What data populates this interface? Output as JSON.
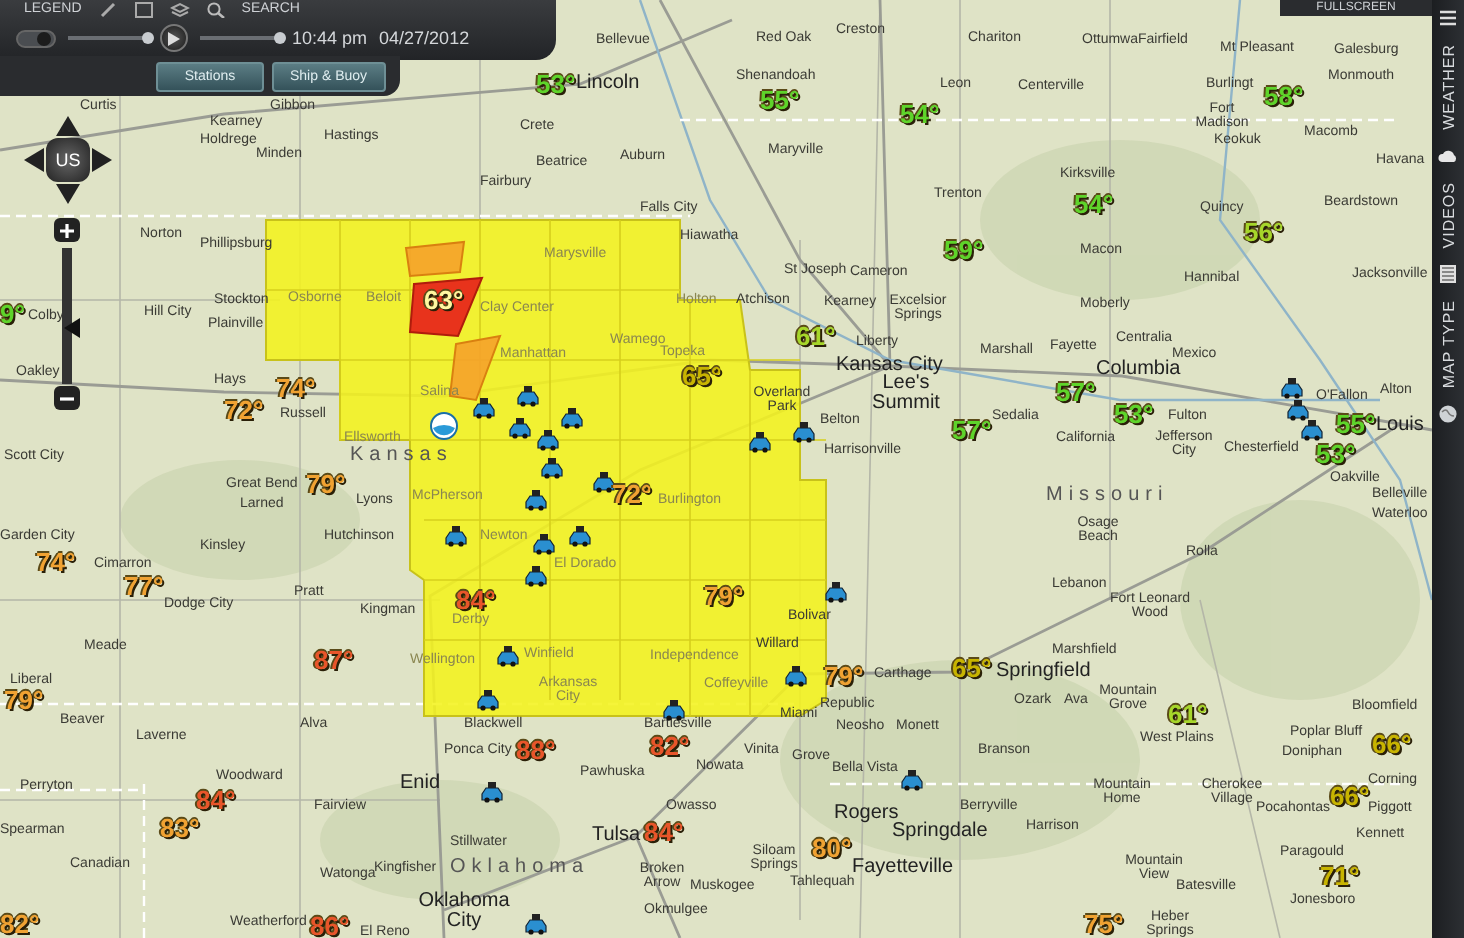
{
  "toolbar": {
    "menu_items": [
      "LEGEND",
      "SEARCH"
    ],
    "fullscreen": "FULLSCREEN"
  },
  "playback": {
    "toggle": {
      "on": true
    },
    "speed": {
      "level": 1
    },
    "time": "10:44 pm",
    "date": "04/27/2012",
    "timeline": {
      "level": 1
    }
  },
  "layer_buttons": [
    {
      "label": "Stations"
    },
    {
      "label": "Ship & Buoy"
    }
  ],
  "side_tabs": [
    "WEATHER",
    "VIDEOS",
    "MAP TYPE"
  ],
  "pan_control": {
    "label": "US"
  },
  "zoom_slider": {
    "level": 0.4
  },
  "cities": [
    {
      "name": "Bellevue",
      "kind": "town"
    },
    {
      "name": "Lincoln",
      "kind": "major"
    },
    {
      "name": "Curtis",
      "kind": "town"
    },
    {
      "name": "Kearney",
      "kind": "town"
    },
    {
      "name": "Gibbon",
      "kind": "town"
    },
    {
      "name": "Holdrege",
      "kind": "town"
    },
    {
      "name": "Minden",
      "kind": "town"
    },
    {
      "name": "Hastings",
      "kind": "town"
    },
    {
      "name": "Crete",
      "kind": "town"
    },
    {
      "name": "Beatrice",
      "kind": "town"
    },
    {
      "name": "Fairbury",
      "kind": "town"
    },
    {
      "name": "Auburn",
      "kind": "town"
    },
    {
      "name": "Falls City",
      "kind": "town"
    },
    {
      "name": "Hiawatha",
      "kind": "town"
    },
    {
      "name": "Norton",
      "kind": "town"
    },
    {
      "name": "Red Oak",
      "kind": "town"
    },
    {
      "name": "Creston",
      "kind": "town"
    },
    {
      "name": "Chariton",
      "kind": "town"
    },
    {
      "name": "Ottumwa",
      "kind": "town"
    },
    {
      "name": "Fairfield",
      "kind": "town"
    },
    {
      "name": "Mt Pleasant",
      "kind": "town"
    },
    {
      "name": "Galesburg",
      "kind": "town"
    },
    {
      "name": "Shenandoah",
      "kind": "town"
    },
    {
      "name": "Leon",
      "kind": "town"
    },
    {
      "name": "Centerville",
      "kind": "town"
    },
    {
      "name": "Burlingt",
      "kind": "town"
    },
    {
      "name": "Fort Madison",
      "kind": "town"
    },
    {
      "name": "Monmouth",
      "kind": "town"
    },
    {
      "name": "Keokuk",
      "kind": "town"
    },
    {
      "name": "Macomb",
      "kind": "town"
    },
    {
      "name": "Havana",
      "kind": "town"
    },
    {
      "name": "Maryville",
      "kind": "town"
    },
    {
      "name": "Kirksville",
      "kind": "town"
    },
    {
      "name": "Trenton",
      "kind": "town"
    },
    {
      "name": "Quincy",
      "kind": "town"
    },
    {
      "name": "Beardstown",
      "kind": "town"
    },
    {
      "name": "Phillipsburg",
      "kind": "town"
    },
    {
      "name": "Hill City",
      "kind": "town"
    },
    {
      "name": "Stockton",
      "kind": "town"
    },
    {
      "name": "Plainville",
      "kind": "town"
    },
    {
      "name": "Colby",
      "kind": "town"
    },
    {
      "name": "Oakley",
      "kind": "town"
    },
    {
      "name": "Hays",
      "kind": "town"
    },
    {
      "name": "Russell",
      "kind": "town"
    },
    {
      "name": "Scott City",
      "kind": "town"
    },
    {
      "name": "Kansas",
      "kind": "state"
    },
    {
      "name": "Great Bend",
      "kind": "town"
    },
    {
      "name": "Larned",
      "kind": "town"
    },
    {
      "name": "Lyons",
      "kind": "town"
    },
    {
      "name": "Garden City",
      "kind": "town"
    },
    {
      "name": "Hutchinson",
      "kind": "town"
    },
    {
      "name": "Cimarron",
      "kind": "town"
    },
    {
      "name": "Kinsley",
      "kind": "town"
    },
    {
      "name": "Osborne",
      "kind": "overlay"
    },
    {
      "name": "Beloit",
      "kind": "overlay"
    },
    {
      "name": "Marysville",
      "kind": "overlay"
    },
    {
      "name": "Clay Center",
      "kind": "overlay"
    },
    {
      "name": "Manhattan",
      "kind": "overlay"
    },
    {
      "name": "Holton",
      "kind": "overlay"
    },
    {
      "name": "Wamego",
      "kind": "overlay"
    },
    {
      "name": "Topeka",
      "kind": "overlay"
    },
    {
      "name": "Salina",
      "kind": "overlay"
    },
    {
      "name": "Ellsworth",
      "kind": "overlay"
    },
    {
      "name": "McPherson",
      "kind": "overlay"
    },
    {
      "name": "Newton",
      "kind": "overlay"
    },
    {
      "name": "El Dorado",
      "kind": "overlay"
    },
    {
      "name": "Burlington",
      "kind": "overlay"
    },
    {
      "name": "St Joseph",
      "kind": "town"
    },
    {
      "name": "Cameron",
      "kind": "town"
    },
    {
      "name": "Macon",
      "kind": "town"
    },
    {
      "name": "Hannibal",
      "kind": "town"
    },
    {
      "name": "Jacksonville",
      "kind": "town"
    },
    {
      "name": "Atchison",
      "kind": "town"
    },
    {
      "name": "Kearney",
      "kind": "town"
    },
    {
      "name": "Excelsior Springs",
      "kind": "town"
    },
    {
      "name": "Moberly",
      "kind": "town"
    },
    {
      "name": "Liberty",
      "kind": "town"
    },
    {
      "name": "Marshall",
      "kind": "town"
    },
    {
      "name": "Fayette",
      "kind": "town"
    },
    {
      "name": "Centralia",
      "kind": "town"
    },
    {
      "name": "Mexico",
      "kind": "town"
    },
    {
      "name": "Kansas City",
      "kind": "major"
    },
    {
      "name": "Columbia",
      "kind": "major"
    },
    {
      "name": "Overland Park",
      "kind": "town"
    },
    {
      "name": "Lee's Summit",
      "kind": "major"
    },
    {
      "name": "Belton",
      "kind": "town"
    },
    {
      "name": "Harrisonville",
      "kind": "town"
    },
    {
      "name": "Sedalia",
      "kind": "town"
    },
    {
      "name": "California",
      "kind": "town"
    },
    {
      "name": "Fulton",
      "kind": "town"
    },
    {
      "name": "Jefferson City",
      "kind": "town"
    },
    {
      "name": "O'Fallon",
      "kind": "town"
    },
    {
      "name": "Alton",
      "kind": "town"
    },
    {
      "name": "Chesterfield",
      "kind": "town"
    },
    {
      "name": "Louis",
      "kind": "major"
    },
    {
      "name": "Oakville",
      "kind": "town"
    },
    {
      "name": "Belleville",
      "kind": "town"
    },
    {
      "name": "Waterloo",
      "kind": "town"
    },
    {
      "name": "Missouri",
      "kind": "state"
    },
    {
      "name": "Osage Beach",
      "kind": "town"
    },
    {
      "name": "Rolla",
      "kind": "town"
    },
    {
      "name": "Lebanon",
      "kind": "town"
    },
    {
      "name": "Dodge City",
      "kind": "town"
    },
    {
      "name": "Pratt",
      "kind": "town"
    },
    {
      "name": "Kingman",
      "kind": "town"
    },
    {
      "name": "Derby",
      "kind": "overlay"
    },
    {
      "name": "Wellington",
      "kind": "overlay"
    },
    {
      "name": "Winfield",
      "kind": "overlay"
    },
    {
      "name": "Arkansas City",
      "kind": "overlay"
    },
    {
      "name": "Independence",
      "kind": "overlay"
    },
    {
      "name": "Coffeyville",
      "kind": "overlay"
    },
    {
      "name": "Meade",
      "kind": "town"
    },
    {
      "name": "Liberal",
      "kind": "town"
    },
    {
      "name": "Beaver",
      "kind": "town"
    },
    {
      "name": "Laverne",
      "kind": "town"
    },
    {
      "name": "Alva",
      "kind": "town"
    },
    {
      "name": "Blackwell",
      "kind": "town"
    },
    {
      "name": "Ponca City",
      "kind": "town"
    },
    {
      "name": "Pawhuska",
      "kind": "town"
    },
    {
      "name": "Bartlesville",
      "kind": "town"
    },
    {
      "name": "Nowata",
      "kind": "town"
    },
    {
      "name": "Perryton",
      "kind": "town"
    },
    {
      "name": "Woodward",
      "kind": "town"
    },
    {
      "name": "Enid",
      "kind": "major"
    },
    {
      "name": "Fairview",
      "kind": "town"
    },
    {
      "name": "Owasso",
      "kind": "town"
    },
    {
      "name": "Spearman",
      "kind": "town"
    },
    {
      "name": "Stillwater",
      "kind": "town"
    },
    {
      "name": "Oklahoma",
      "kind": "state"
    },
    {
      "name": "Tulsa",
      "kind": "major"
    },
    {
      "name": "Broken Arrow",
      "kind": "town"
    },
    {
      "name": "Canadian",
      "kind": "town"
    },
    {
      "name": "Watonga",
      "kind": "town"
    },
    {
      "name": "Kingfisher",
      "kind": "town"
    },
    {
      "name": "Weatherford",
      "kind": "town"
    },
    {
      "name": "El Reno",
      "kind": "town"
    },
    {
      "name": "Oklahoma City",
      "kind": "major"
    },
    {
      "name": "Muskogee",
      "kind": "town"
    },
    {
      "name": "Okmulgee",
      "kind": "town"
    },
    {
      "name": "Bolivar",
      "kind": "town"
    },
    {
      "name": "Fort Leonard Wood",
      "kind": "town"
    },
    {
      "name": "Willard",
      "kind": "town"
    },
    {
      "name": "Marshfield",
      "kind": "town"
    },
    {
      "name": "Carthage",
      "kind": "town"
    },
    {
      "name": "Springfield",
      "kind": "major"
    },
    {
      "name": "Miami",
      "kind": "town"
    },
    {
      "name": "Republic",
      "kind": "town"
    },
    {
      "name": "Ozark",
      "kind": "town"
    },
    {
      "name": "Ava",
      "kind": "town"
    },
    {
      "name": "Mountain Grove",
      "kind": "town"
    },
    {
      "name": "Bloomfield",
      "kind": "town"
    },
    {
      "name": "Neosho",
      "kind": "town"
    },
    {
      "name": "Monett",
      "kind": "town"
    },
    {
      "name": "West Plains",
      "kind": "town"
    },
    {
      "name": "Poplar Bluff",
      "kind": "town"
    },
    {
      "name": "Vinita",
      "kind": "town"
    },
    {
      "name": "Grove",
      "kind": "town"
    },
    {
      "name": "Bella Vista",
      "kind": "town"
    },
    {
      "name": "Branson",
      "kind": "town"
    },
    {
      "name": "Doniphan",
      "kind": "town"
    },
    {
      "name": "Mountain Home",
      "kind": "town"
    },
    {
      "name": "Cherokee Village",
      "kind": "town"
    },
    {
      "name": "Corning",
      "kind": "town"
    },
    {
      "name": "Rogers",
      "kind": "major"
    },
    {
      "name": "Berryville",
      "kind": "town"
    },
    {
      "name": "Pocahontas",
      "kind": "town"
    },
    {
      "name": "Piggott",
      "kind": "town"
    },
    {
      "name": "Springdale",
      "kind": "major"
    },
    {
      "name": "Harrison",
      "kind": "town"
    },
    {
      "name": "Kennett",
      "kind": "town"
    },
    {
      "name": "Siloam Springs",
      "kind": "town"
    },
    {
      "name": "Fayetteville",
      "kind": "major"
    },
    {
      "name": "Mountain View",
      "kind": "town"
    },
    {
      "name": "Paragould",
      "kind": "town"
    },
    {
      "name": "Tahlequah",
      "kind": "town"
    },
    {
      "name": "Batesville",
      "kind": "town"
    },
    {
      "name": "Jonesboro",
      "kind": "town"
    },
    {
      "name": "Heber Springs",
      "kind": "town"
    }
  ],
  "temperatures": [
    {
      "value": "53°",
      "color": "#5ed42a"
    },
    {
      "value": "55°",
      "color": "#5ed42a"
    },
    {
      "value": "54°",
      "color": "#5ed42a"
    },
    {
      "value": "58°",
      "color": "#5ed42a"
    },
    {
      "value": "54°",
      "color": "#5ed42a"
    },
    {
      "value": "56°",
      "color": "#a6d62a"
    },
    {
      "value": "59°",
      "color": "#5ed42a"
    },
    {
      "value": "9°",
      "color": "#5ed42a"
    },
    {
      "value": "63°",
      "color": "#fff7a0"
    },
    {
      "value": "61°",
      "color": "#a6d62a"
    },
    {
      "value": "65°",
      "color": "#c8b400"
    },
    {
      "value": "72°",
      "color": "#f0a232"
    },
    {
      "value": "74°",
      "color": "#f0a232"
    },
    {
      "value": "57°",
      "color": "#5ed42a"
    },
    {
      "value": "53°",
      "color": "#5ed42a"
    },
    {
      "value": "57°",
      "color": "#5ed42a"
    },
    {
      "value": "72°",
      "color": "#f0a232"
    },
    {
      "value": "55°",
      "color": "#5ed42a"
    },
    {
      "value": "53°",
      "color": "#5ed42a"
    },
    {
      "value": "79°",
      "color": "#f0a232"
    },
    {
      "value": "74°",
      "color": "#f0a232"
    },
    {
      "value": "77°",
      "color": "#f0a232"
    },
    {
      "value": "84°",
      "color": "#e8552a"
    },
    {
      "value": "79°",
      "color": "#f0a232"
    },
    {
      "value": "87°",
      "color": "#e8552a"
    },
    {
      "value": "79°",
      "color": "#f0a232"
    },
    {
      "value": "88°",
      "color": "#e8552a"
    },
    {
      "value": "82°",
      "color": "#e8552a"
    },
    {
      "value": "84°",
      "color": "#e8552a"
    },
    {
      "value": "83°",
      "color": "#f0a232"
    },
    {
      "value": "84°",
      "color": "#e8552a"
    },
    {
      "value": "82°",
      "color": "#f0a232"
    },
    {
      "value": "86°",
      "color": "#e8552a"
    },
    {
      "value": "79°",
      "color": "#f0a232"
    },
    {
      "value": "65°",
      "color": "#c8b400"
    },
    {
      "value": "61°",
      "color": "#a6d62a"
    },
    {
      "value": "66°",
      "color": "#c8b400"
    },
    {
      "value": "66°",
      "color": "#c8b400"
    },
    {
      "value": "80°",
      "color": "#f0a232"
    },
    {
      "value": "71°",
      "color": "#c8b400"
    },
    {
      "value": "75°",
      "color": "#f0a232"
    }
  ]
}
